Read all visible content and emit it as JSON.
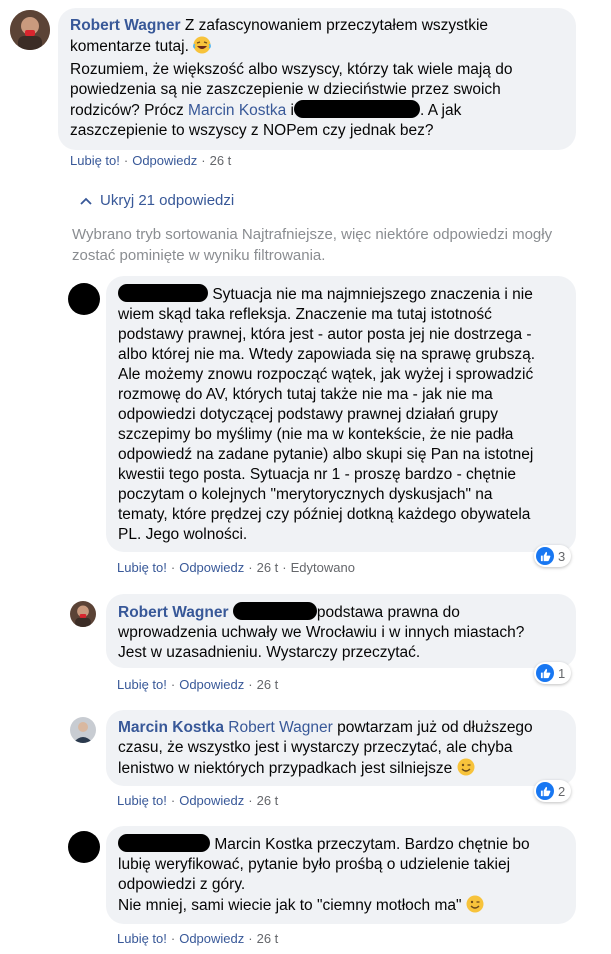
{
  "comment_main": {
    "author": "Robert Wagner",
    "line1": "Z zafascynowaniem przeczytałem wszystkie",
    "line2": "komentarze tutaj.",
    "line3": "Rozumiem, że większość albo wszyscy, którzy tak wiele mają do",
    "line4": "powiedzenia są nie zaszczepienie w dzieciństwie przez swoich",
    "line5_pre": "rodziców? Prócz",
    "line5_mention": "Marcin Kostka",
    "line5_mid": " i",
    "line5_post": ". A jak",
    "line6": "zaszczepienie to wszyscy z NOPem czy jednak bez?",
    "like": "Lubię to!",
    "reply": "Odpowiedz",
    "time": "26 t"
  },
  "replies_toggle": {
    "label": "Ukryj 21 odpowiedzi"
  },
  "filter_note": {
    "line1": "Wybrano tryb sortowania Najtrafniejsze, więc niektóre odpowiedzi mogły",
    "line2": "zostać pominięte w wyniku filtrowania."
  },
  "reply1": {
    "lines": [
      "Sytuacja nie ma najmniejszego znaczenia i nie",
      "wiem skąd taka refleksja. Znaczenie ma tutaj istotność",
      "podstawy prawnej, która jest - autor posta jej nie dostrzega -",
      "albo której nie ma. Wtedy zapowiada się na sprawę grubszą.",
      "Ale możemy znowu rozpocząć wątek, jak wyżej i sprowadzić",
      "rozmowę do AV, których tutaj także nie ma - jak nie ma",
      "odpowiedzi dotyczącej podstawy prawnej działań grupy",
      "szczepimy bo myślimy (nie ma w kontekście, że nie padła",
      "odpowiedź na zadane pytanie) albo skupi się Pan na istotnej",
      "kwestii tego posta. Sytuacja nr 1 - proszę bardzo - chętnie",
      "poczytam o kolejnych \"merytorycznych dyskusjach\" na",
      "tematy, które prędzej czy później dotkną każdego obywatela",
      "PL. Jego wolności."
    ],
    "like": "Lubię to!",
    "reply": "Odpowiedz",
    "time": "26 t",
    "edited": "Edytowano",
    "reaction_count": "3"
  },
  "reply2": {
    "author": "Robert Wagner",
    "line1": "podstawa prawna do",
    "line2": "wprowadzenia uchwały we Wrocławiu i w innych miastach?",
    "line3": "Jest w uzasadnieniu. Wystarczy przeczytać.",
    "like": "Lubię to!",
    "reply": "Odpowiedz",
    "time": "26 t",
    "reaction_count": "1"
  },
  "reply3": {
    "author": "Marcin Kostka",
    "mention": "Robert Wagner",
    "line1": " powtarzam już od dłuższego",
    "line2": "czasu, że wszystko jest i wystarczy przeczytać, ale chyba",
    "line3": "lenistwo w niektórych przypadkach jest silniejsze",
    "like": "Lubię to!",
    "reply": "Odpowiedz",
    "time": "26 t",
    "reaction_count": "2"
  },
  "reply4": {
    "line1": "Marcin Kostka przeczytam. Bardzo chętnie bo",
    "line2": "lubię weryfikować, pytanie było prośbą o udzielenie takiej",
    "line3": "odpowiedzi z góry.",
    "line4": "Nie mniej, sami wiecie jak to \"ciemny motłoch ma\"",
    "like": "Lubię to!",
    "reply": "Odpowiedz",
    "time": "26 t"
  }
}
